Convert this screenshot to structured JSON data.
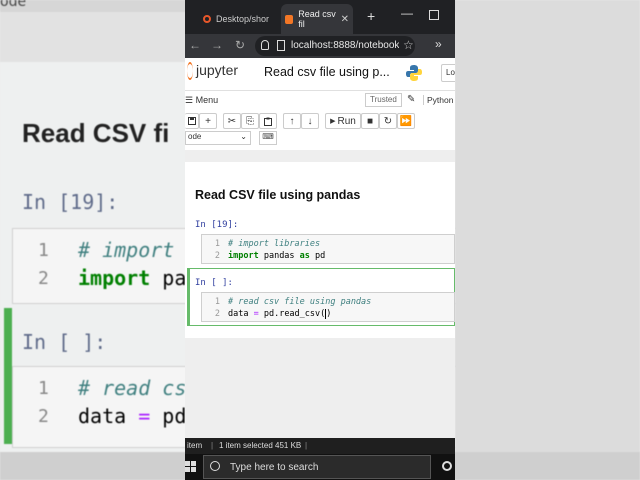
{
  "background": {
    "top_text": "ode",
    "heading": "Read CSV fi",
    "prompt1": "In [19]:",
    "code1": [
      {
        "num": "1",
        "text": "# import",
        "kind": "comment"
      },
      {
        "num": "2",
        "kw": "import",
        "rest": " pa"
      }
    ],
    "prompt2": "In [ ]:",
    "code2": [
      {
        "num": "1",
        "text": "# read cs",
        "kind": "comment"
      },
      {
        "num": "2",
        "var": "data",
        "op": " = ",
        "rest": "pd"
      }
    ]
  },
  "browser": {
    "tab1_label": "Desktop/shor",
    "tab2_label": "Read csv fil",
    "new_tab": "+",
    "minimize": "—",
    "url": "localhost:8888/notebooks"
  },
  "jupyter": {
    "logo_text": "jupyter",
    "notebook_title": "Read csv file using p...",
    "logout_label": "Lo",
    "menu_label": "Menu",
    "trusted_label": "Trusted",
    "kernel_label": "Python",
    "toolbar": {
      "save": "",
      "add": "+",
      "cut": "✂",
      "copy": "⎘",
      "paste": "📋",
      "up": "↑",
      "down": "↓",
      "run": "Run",
      "stop": "■",
      "restart": "↻",
      "fastforward": "⏩"
    },
    "cell_type": "ode"
  },
  "notebook": {
    "heading": "Read CSV file using pandas",
    "cell1": {
      "prompt": "In [19]:",
      "line1": {
        "num": "1",
        "comment": "# import libraries"
      },
      "line2": {
        "num": "2",
        "kw1": "import",
        "mid": " pandas ",
        "kw2": "as",
        "rest": " pd"
      }
    },
    "cell2": {
      "prompt": "In [ ]:",
      "line1": {
        "num": "1",
        "comment": "# read csv file using pandas"
      },
      "line2": {
        "num": "2",
        "var": "data",
        "op": " = ",
        "rest": "pd.read_csv(",
        "cursor": ")"
      }
    }
  },
  "explorer_status": {
    "items": "item",
    "selected": "1 item selected",
    "size": "451 KB"
  },
  "taskbar": {
    "search_placeholder": "Type here to search"
  }
}
